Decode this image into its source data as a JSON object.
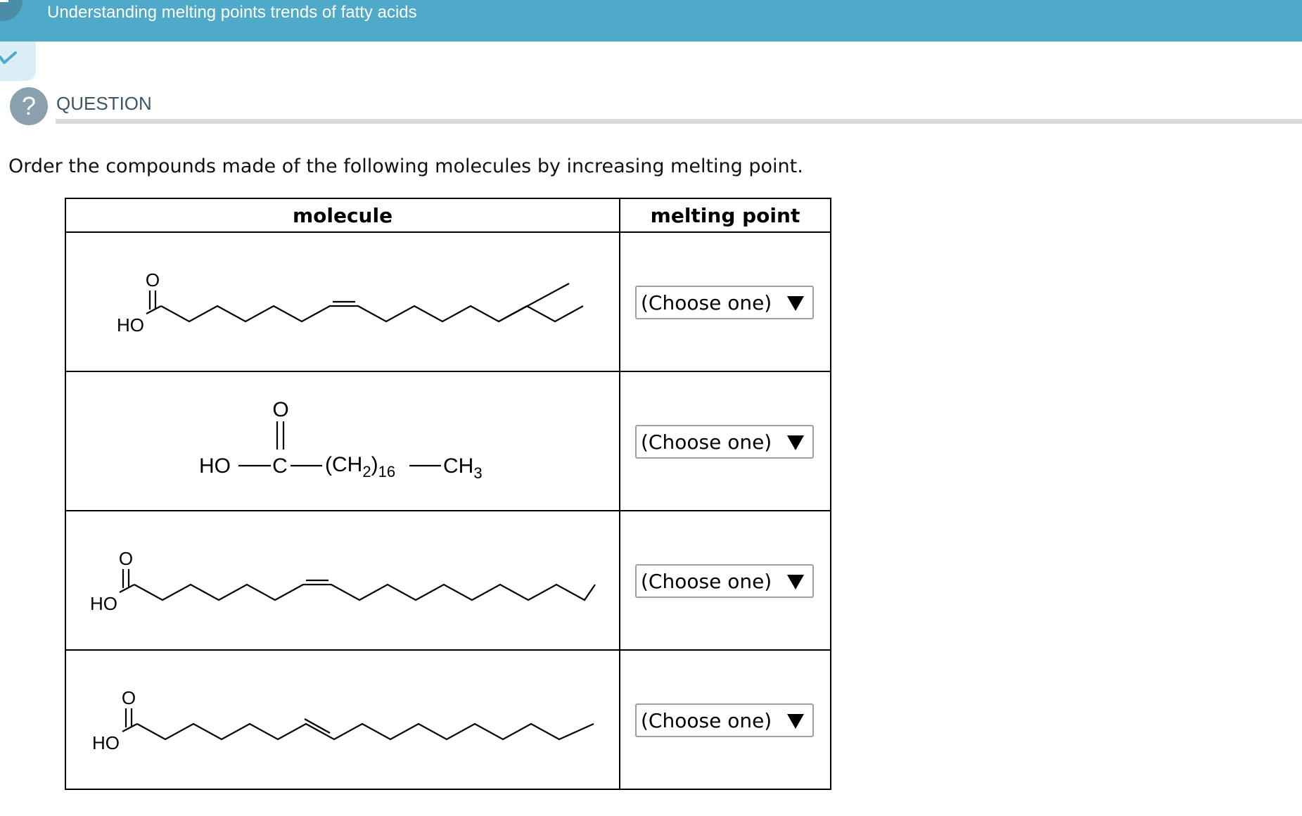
{
  "header": {
    "title": "Understanding melting points trends of fatty acids"
  },
  "question": {
    "label": "QUESTION",
    "icon_glyph": "?",
    "prompt": "Order the compounds made of the following molecules by increasing melting point."
  },
  "table": {
    "columns": [
      "molecule",
      "melting point"
    ],
    "rows": [
      {
        "molecule": {
          "ho": "HO",
          "o": "O"
        },
        "select_value": "(Choose one)"
      },
      {
        "molecule": {
          "ho": "HO",
          "c": "C",
          "o": "O",
          "ch2": "(CH",
          "sub2": "2",
          "paren": ")",
          "sub16": "16",
          "ch3": "CH",
          "sub3": "3"
        },
        "select_value": "(Choose one)"
      },
      {
        "molecule": {
          "ho": "HO",
          "o": "O"
        },
        "select_value": "(Choose one)"
      },
      {
        "molecule": {
          "ho": "HO",
          "o": "O"
        },
        "select_value": "(Choose one)"
      }
    ]
  },
  "colors": {
    "header_bar": "#4faac9",
    "check_tab": "#daeef6",
    "check_mark": "#4faac9",
    "question_icon": "#8aa0ad"
  }
}
